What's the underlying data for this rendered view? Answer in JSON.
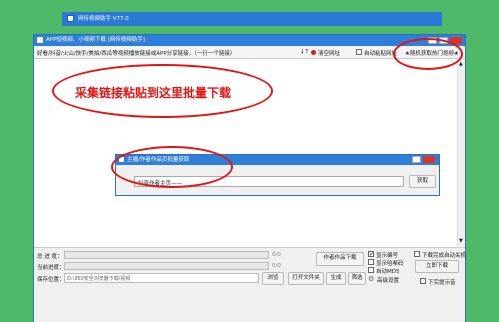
{
  "bg_window": {
    "title": "网传视频助手 V77.0"
  },
  "main_window": {
    "title": "APP短视频、小视频下载 [网传视频助手]",
    "url_hint": "好看/抖音/火山/快手/美拍/西瓜等视频播放链接或APP分享链接，（一行一个链接）",
    "sort_icon": "↓↑",
    "clear_label": "清空网址",
    "auto_paste_label": "自动粘贴网址",
    "random_hot_label": "★随机获取热门视频★"
  },
  "annotation": {
    "text": "采集链接粘贴到这里批量下载"
  },
  "dialog": {
    "title": "主播/作者作品页批量获取",
    "input_value": "抖音作者主页——",
    "fetch_button": "获取"
  },
  "bottom": {
    "total_progress_label": "总  进  度：",
    "total_progress_value": "0/0",
    "current_progress_label": "当前进度：",
    "current_progress_value": "0/0",
    "save_location_label": "保存位置：",
    "save_path": "D:\\360安全浏览器下载\\视频",
    "browse_button": "浏览",
    "open_folder_button": "打开文件夹",
    "generate_button": "生成",
    "author_download_button": "作者作品下载",
    "filter_button": "筛选",
    "check_show_number": "显示编号",
    "check_show_hash": "显示哈希码",
    "check_auto_md5": "自动MD5",
    "advanced_settings": "高级设置",
    "check_auto_shutdown": "下载完成自动关机",
    "download_now_button": "立即下载",
    "check_no_prompt": "下完提示音"
  }
}
